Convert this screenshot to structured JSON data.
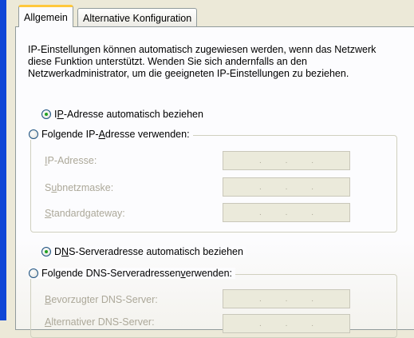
{
  "tabs": [
    {
      "label": "Allgemein",
      "active": true
    },
    {
      "label": "Alternative Konfiguration",
      "active": false
    }
  ],
  "description": "IP-Einstellungen können automatisch zugewiesen werden, wenn das Netzwerk diese Funktion unterstützt. Wenden Sie sich andernfalls an den Netzwerkadministrator, um die geeigneten IP-Einstellungen zu beziehen.",
  "ip": {
    "auto": {
      "pre": "I",
      "accel": "P",
      "post": "-Adresse automatisch beziehen",
      "checked": true
    },
    "manual": {
      "pre": "Folgende IP-",
      "accel": "A",
      "post": "dresse verwenden:",
      "checked": false
    },
    "fields": [
      {
        "pre": "",
        "accel": "I",
        "post": "P-Adresse:"
      },
      {
        "pre": "S",
        "accel": "u",
        "post": "bnetzmaske:"
      },
      {
        "pre": "",
        "accel": "S",
        "post": "tandardgateway:"
      }
    ]
  },
  "dns": {
    "auto": {
      "pre": "D",
      "accel": "N",
      "post": "S-Serveradresse automatisch beziehen",
      "checked": true
    },
    "manual": {
      "pre": "Folgende DNS-Serveradressen ",
      "accel": "v",
      "post": "erwenden:",
      "checked": false
    },
    "fields": [
      {
        "pre": "",
        "accel": "B",
        "post": "evorzugter DNS-Server:"
      },
      {
        "pre": "",
        "accel": "A",
        "post": "lternativer DNS-Server:"
      }
    ]
  },
  "ip_dot": ".",
  "colors": {
    "accent_tab": "#ffc83c",
    "radio_dot": "#21a121",
    "window_frame": "#0f46d6"
  }
}
